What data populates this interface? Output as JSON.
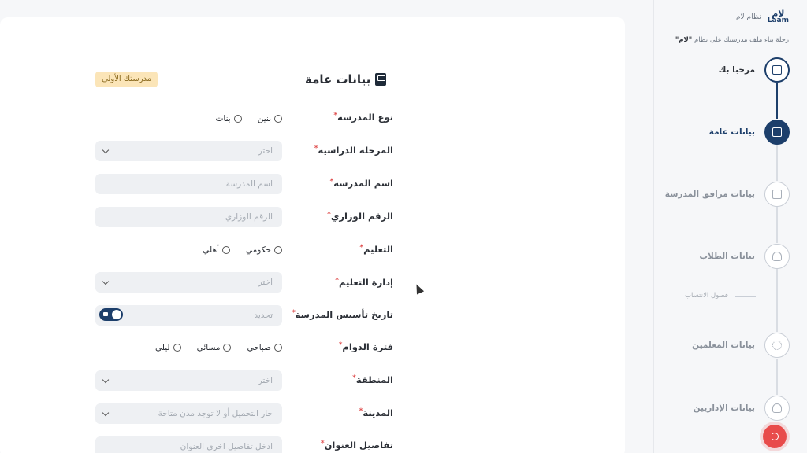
{
  "form": {
    "title": "بيانات عامة",
    "badge": "مدرستك الأولى",
    "required_mark": "*",
    "fields": {
      "school_type": {
        "label": "نوع المدرسة",
        "options": [
          "بنين",
          "بنات"
        ]
      },
      "stage": {
        "label": "المرحلة الدراسية",
        "placeholder": "اختر"
      },
      "school_name": {
        "label": "اسم المدرسة",
        "placeholder": "اسم المدرسة"
      },
      "ministry_no": {
        "label": "الرقم الوزاري",
        "placeholder": "الرقم الوزاري"
      },
      "education": {
        "label": "التعليم",
        "options": [
          "حكومي",
          "أهلي"
        ]
      },
      "edu_admin": {
        "label": "إدارة التعليم",
        "placeholder": "اختر"
      },
      "founding_date": {
        "label": "تاريخ تأسيس المدرسة",
        "placeholder": "تحديد"
      },
      "shift": {
        "label": "فترة الدوام",
        "options": [
          "صباحي",
          "مسائي",
          "ليلي"
        ]
      },
      "region": {
        "label": "المنطقة",
        "placeholder": "اختر"
      },
      "city": {
        "label": "المدينة",
        "placeholder": "جار التحميل أو لا توجد مدن متاحة"
      },
      "address": {
        "label": "تفاصيل العنوان",
        "placeholder": "ادخل تفاصيل اخرى العنوان"
      }
    }
  },
  "sidebar": {
    "brand_name": "نظام لام",
    "logo_ar": "لام",
    "logo_en": "Laam",
    "tagline_prefix": "رحلة بناء ملف مدرستك على نظام",
    "tagline_brand": "\"لام\"",
    "steps": [
      {
        "label": "مرحبا بك",
        "state": "done",
        "icon": "building-icon"
      },
      {
        "label": "بيانات عامة",
        "state": "active",
        "icon": "document-icon"
      },
      {
        "label": "بيانات مرافق المدرسة",
        "state": "pending",
        "icon": "pencil-icon"
      },
      {
        "label": "بيانات الطلاب",
        "state": "pending",
        "icon": "users-icon"
      },
      {
        "label": "بيانات المعلمين",
        "state": "pending",
        "icon": "group-icon"
      },
      {
        "label": "بيانات الإداريين",
        "state": "pending",
        "icon": "person-icon"
      }
    ],
    "sub_step": "فصول الانتساب"
  },
  "colors": {
    "primary": "#1d3f6b",
    "badge_bg": "#fbe5b8",
    "danger": "#e84b4b"
  }
}
